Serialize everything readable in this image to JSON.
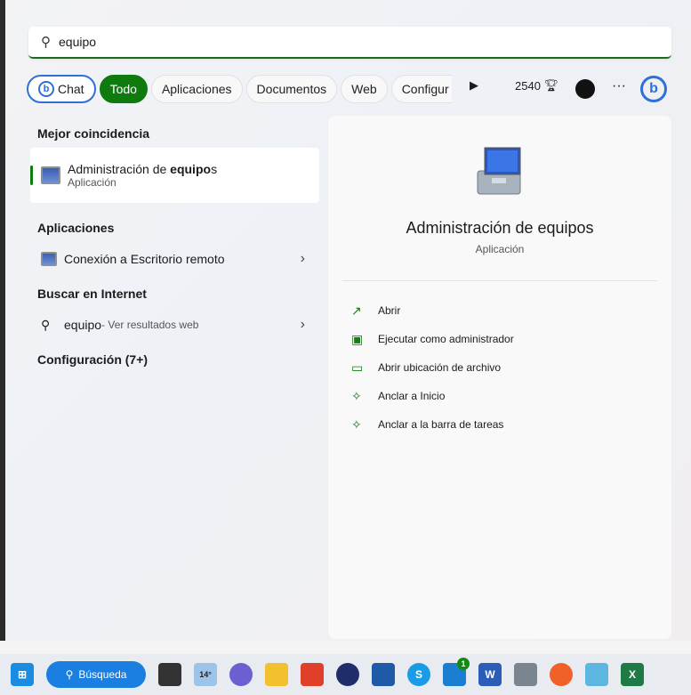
{
  "search": {
    "query": "equipo"
  },
  "chips": {
    "chat": "Chat",
    "todo": "Todo",
    "apps": "Aplicaciones",
    "docs": "Documentos",
    "web": "Web",
    "config": "Configur"
  },
  "rewards": {
    "points": "2540"
  },
  "left": {
    "best_match_heading": "Mejor coincidencia",
    "best_match": {
      "name_prefix": "Administración de ",
      "name_bold": "equipo",
      "name_suffix": "s",
      "type": "Aplicación"
    },
    "apps_heading": "Aplicaciones",
    "apps": [
      {
        "name": "Conexión a Escritorio remoto"
      }
    ],
    "web_heading": "Buscar en Internet",
    "web": {
      "query": "equipo",
      "hint": " - Ver resultados web"
    },
    "settings_heading": "Configuración (7+)"
  },
  "detail": {
    "title": "Administración de equipos",
    "type": "Aplicación",
    "actions": [
      {
        "label": "Abrir",
        "icon": "open-external-icon"
      },
      {
        "label": "Ejecutar como administrador",
        "icon": "shield-admin-icon"
      },
      {
        "label": "Abrir ubicación de archivo",
        "icon": "folder-icon"
      },
      {
        "label": "Anclar a Inicio",
        "icon": "pin-icon"
      },
      {
        "label": "Anclar a la barra de tareas",
        "icon": "pin-icon"
      }
    ]
  },
  "taskbar": {
    "search_label": "Búsqueda",
    "weather_temp": "14°",
    "mail_badge": "1"
  },
  "colors": {
    "accent": "#0f7b0f",
    "bing": "#2f6fd8",
    "taskbar_search": "#1a7fe0"
  }
}
